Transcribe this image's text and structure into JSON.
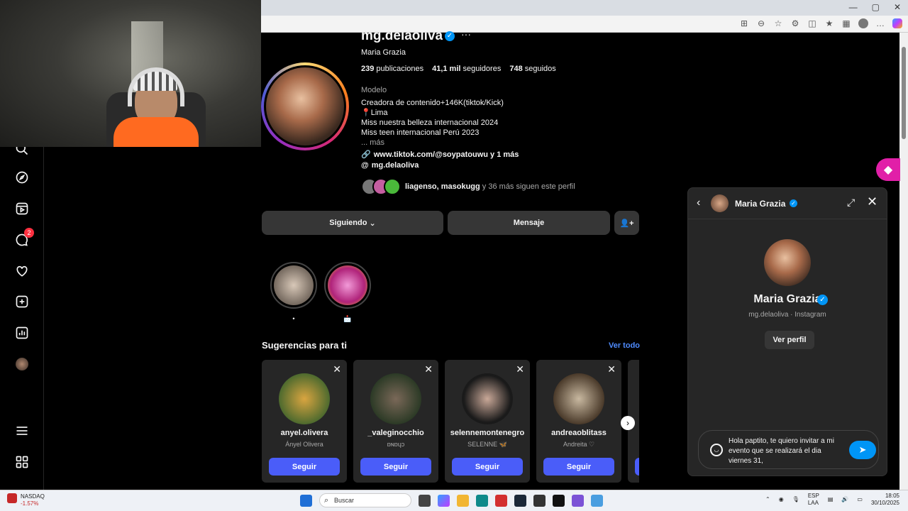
{
  "profile": {
    "username": "mg.delaoliva",
    "full_name": "Maria Grazia",
    "posts": "239",
    "posts_label": "publicaciones",
    "followers": "41,1 mil",
    "followers_label": "seguidores",
    "following": "748",
    "following_label": "seguidos",
    "category": "Modelo",
    "bio": [
      "Creadora de contenido+146K(tiktok/Kick)",
      "📍Lima",
      "Miss nuestra belleza internacional 2024",
      "Miss teen internacional Perú 2023"
    ],
    "bio_more": "... más",
    "link": "www.tiktok.com/@soypatouwu y 1 más",
    "threads": "mg.delaoliva",
    "followed_by_names": "liagenso, masokugg",
    "followed_by_rest": " y 36 más siguen este perfil"
  },
  "actions": {
    "following": "Siguiendo",
    "message": "Mensaje"
  },
  "highlights": [
    {
      "label": "•"
    },
    {
      "label": "📩"
    }
  ],
  "suggestions": {
    "title": "Sugerencias para ti",
    "see_all": "Ver todo",
    "follow_label": "Seguir",
    "cards": [
      {
        "username": "anyel.olivera",
        "name": "Ányel Olivera"
      },
      {
        "username": "_valeginocchio",
        "name": "ɒɴɒɥɔ"
      },
      {
        "username": "selennemontenegro",
        "name": "SELENNE 🦋"
      },
      {
        "username": "andreaoblitass",
        "name": "Andreita ♡"
      }
    ]
  },
  "nav": {
    "notifications_badge": "2"
  },
  "chat": {
    "name": "Maria Grazia",
    "subtitle": "mg.delaoliva · Instagram",
    "view_profile": "Ver perfil",
    "draft": "Hola paptito, te quiero invitar a mi evento que se realizará el dia viernes 31,"
  },
  "taskbar": {
    "stock_name": "NASDAQ",
    "stock_change": "-1.57%",
    "search_placeholder": "Buscar",
    "lang": "ESP",
    "region": "LAA",
    "time": "18:05",
    "date": "30/10/2025"
  },
  "colors": {
    "accent_blue": "#0095f6",
    "follow_button": "#4a5df9",
    "link_blue": "#4f8cff",
    "badge_red": "#ff3040"
  }
}
